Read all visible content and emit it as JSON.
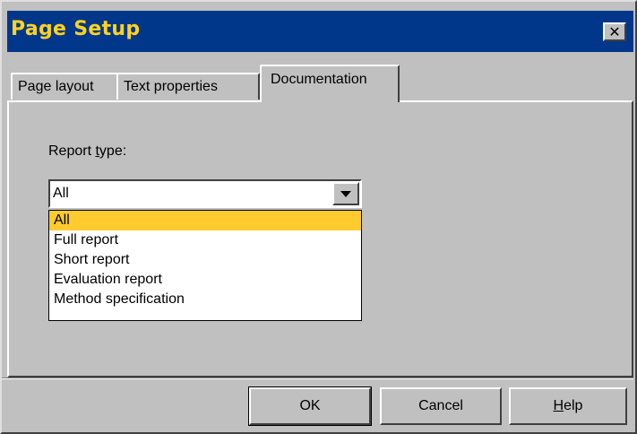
{
  "window": {
    "title": "Page Setup"
  },
  "tabs": [
    {
      "label": "Page layout"
    },
    {
      "label": "Text properties"
    },
    {
      "label": "Documentation"
    }
  ],
  "report_type": {
    "label_prefix": "Report ",
    "label_mnemonic": "t",
    "label_suffix": "ype:",
    "selected": "All",
    "options": [
      "All",
      "Full report",
      "Short report",
      "Evaluation report",
      "Method specification"
    ]
  },
  "buttons": {
    "ok": "OK",
    "cancel": "Cancel",
    "help_mnemonic": "H",
    "help_rest": "elp"
  },
  "icons": {
    "close": "close-icon",
    "dropdown": "chevron-down-icon"
  },
  "colors": {
    "titlebar": "#00378a",
    "title_text": "#ffd21f",
    "selection": "#ffcb2e"
  }
}
